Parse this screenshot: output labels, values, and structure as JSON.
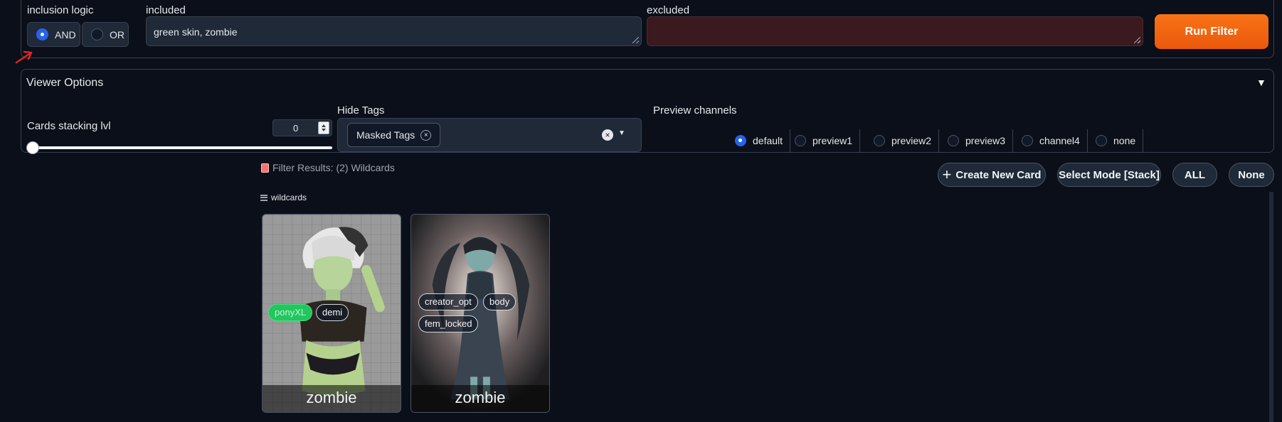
{
  "filter": {
    "inclusion_label": "inclusion logic",
    "and_label": "AND",
    "or_label": "OR",
    "included_label": "included",
    "included_value": "green skin, zombie",
    "excluded_label": "excluded",
    "excluded_value": "",
    "run_label": "Run Filter"
  },
  "viewer": {
    "title": "Viewer Options",
    "collapse_icon": "▼",
    "stacking_label": "Cards stacking lvl",
    "stacking_value": "0",
    "slider_value": 0,
    "hide_tags_label": "Hide Tags",
    "hidden_tag": "Masked Tags",
    "chip_remove": "×",
    "clear_icon": "×",
    "dropdown_icon": "▼",
    "preview_label": "Preview channels",
    "channels": [
      "default",
      "preview1",
      "preview2",
      "preview3",
      "channel4",
      "none"
    ],
    "selected_channel": "default"
  },
  "results": {
    "header": "Filter Results: (2) Wildcards",
    "group_label": "wildcards",
    "buttons": {
      "create": "Create New Card",
      "create_icon": "+",
      "select_mode": "Select Mode [Stack]",
      "all": "ALL",
      "none": "None"
    },
    "cards": [
      {
        "title": "zombie",
        "tags": [
          "ponyXL",
          "demi"
        ]
      },
      {
        "title": "zombie",
        "tags": [
          "creator_opt",
          "body",
          "fem_locked"
        ]
      }
    ]
  },
  "colors": {
    "accent_orange": "#f97316",
    "radio_blue": "#2563eb",
    "excluded_bg": "#3a1a1f",
    "tag_green": "#22c55e"
  }
}
